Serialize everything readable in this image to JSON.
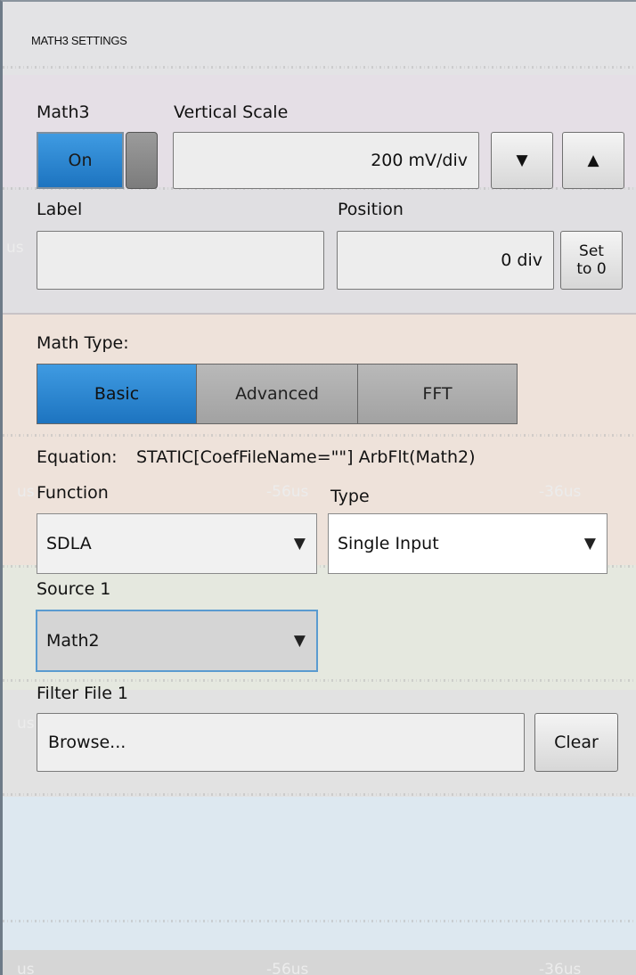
{
  "header": {
    "title": "MATH3 SETTINGS"
  },
  "math3": {
    "label": "Math3",
    "toggle_on_label": "On"
  },
  "vertical_scale": {
    "label": "Vertical Scale",
    "value": "200 mV/div",
    "down_icon": "triangle-down-icon",
    "up_icon": "triangle-up-icon"
  },
  "label_field": {
    "label": "Label",
    "value": ""
  },
  "position": {
    "label": "Position",
    "value": "0 div",
    "set_to_zero_line1": "Set",
    "set_to_zero_line2": "to 0"
  },
  "math_type": {
    "label": "Math Type:",
    "options": [
      "Basic",
      "Advanced",
      "FFT"
    ],
    "selected": "Basic"
  },
  "equation": {
    "label": "Equation:",
    "value": "STATIC[CoefFileName=\"\"] ArbFlt(Math2)"
  },
  "function": {
    "label": "Function",
    "value": "SDLA"
  },
  "type": {
    "label": "Type",
    "value": "Single Input"
  },
  "source1": {
    "label": "Source 1",
    "value": "Math2"
  },
  "filter_file1": {
    "label": "Filter File 1",
    "value": "Browse...",
    "clear_label": "Clear"
  },
  "background_ticks": [
    "us",
    "-56us",
    "-36us",
    "us",
    "-56us",
    "-36us",
    "us",
    "us",
    "-56us",
    "-36us"
  ],
  "colors": {
    "accent_blue": "#2a86d4",
    "focus_border": "#5a9bd0"
  }
}
